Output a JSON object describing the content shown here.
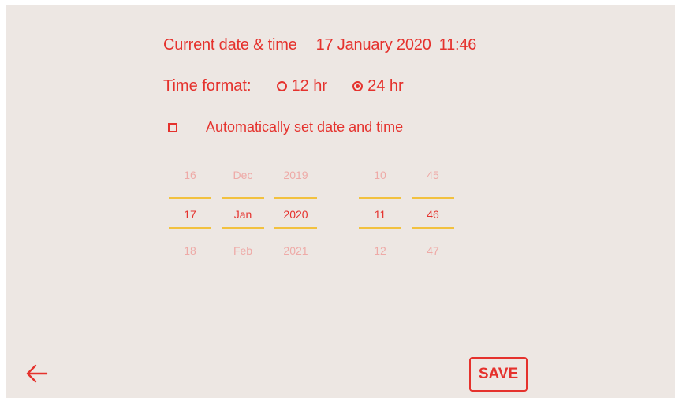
{
  "header": {
    "label": "Current date & time",
    "date": "17 January 2020",
    "time": "11:46"
  },
  "time_format": {
    "label": "Time format:",
    "options": [
      {
        "label": "12 hr",
        "selected": false
      },
      {
        "label": "24 hr",
        "selected": true
      }
    ]
  },
  "auto_set": {
    "label": "Automatically set date and time",
    "checked": false
  },
  "pickers": {
    "day": {
      "prev": "16",
      "current": "17",
      "next": "18"
    },
    "month": {
      "prev": "Dec",
      "current": "Jan",
      "next": "Feb"
    },
    "year": {
      "prev": "2019",
      "current": "2020",
      "next": "2021"
    },
    "hour": {
      "prev": "10",
      "current": "11",
      "next": "12"
    },
    "minute": {
      "prev": "45",
      "current": "46",
      "next": "47"
    }
  },
  "footer": {
    "back_icon": "arrow-left-icon",
    "save_label": "SAVE"
  },
  "colors": {
    "accent": "#e5322d",
    "faded": "#eeaaa7",
    "underline": "#f2c13f",
    "background": "#ede7e3"
  }
}
